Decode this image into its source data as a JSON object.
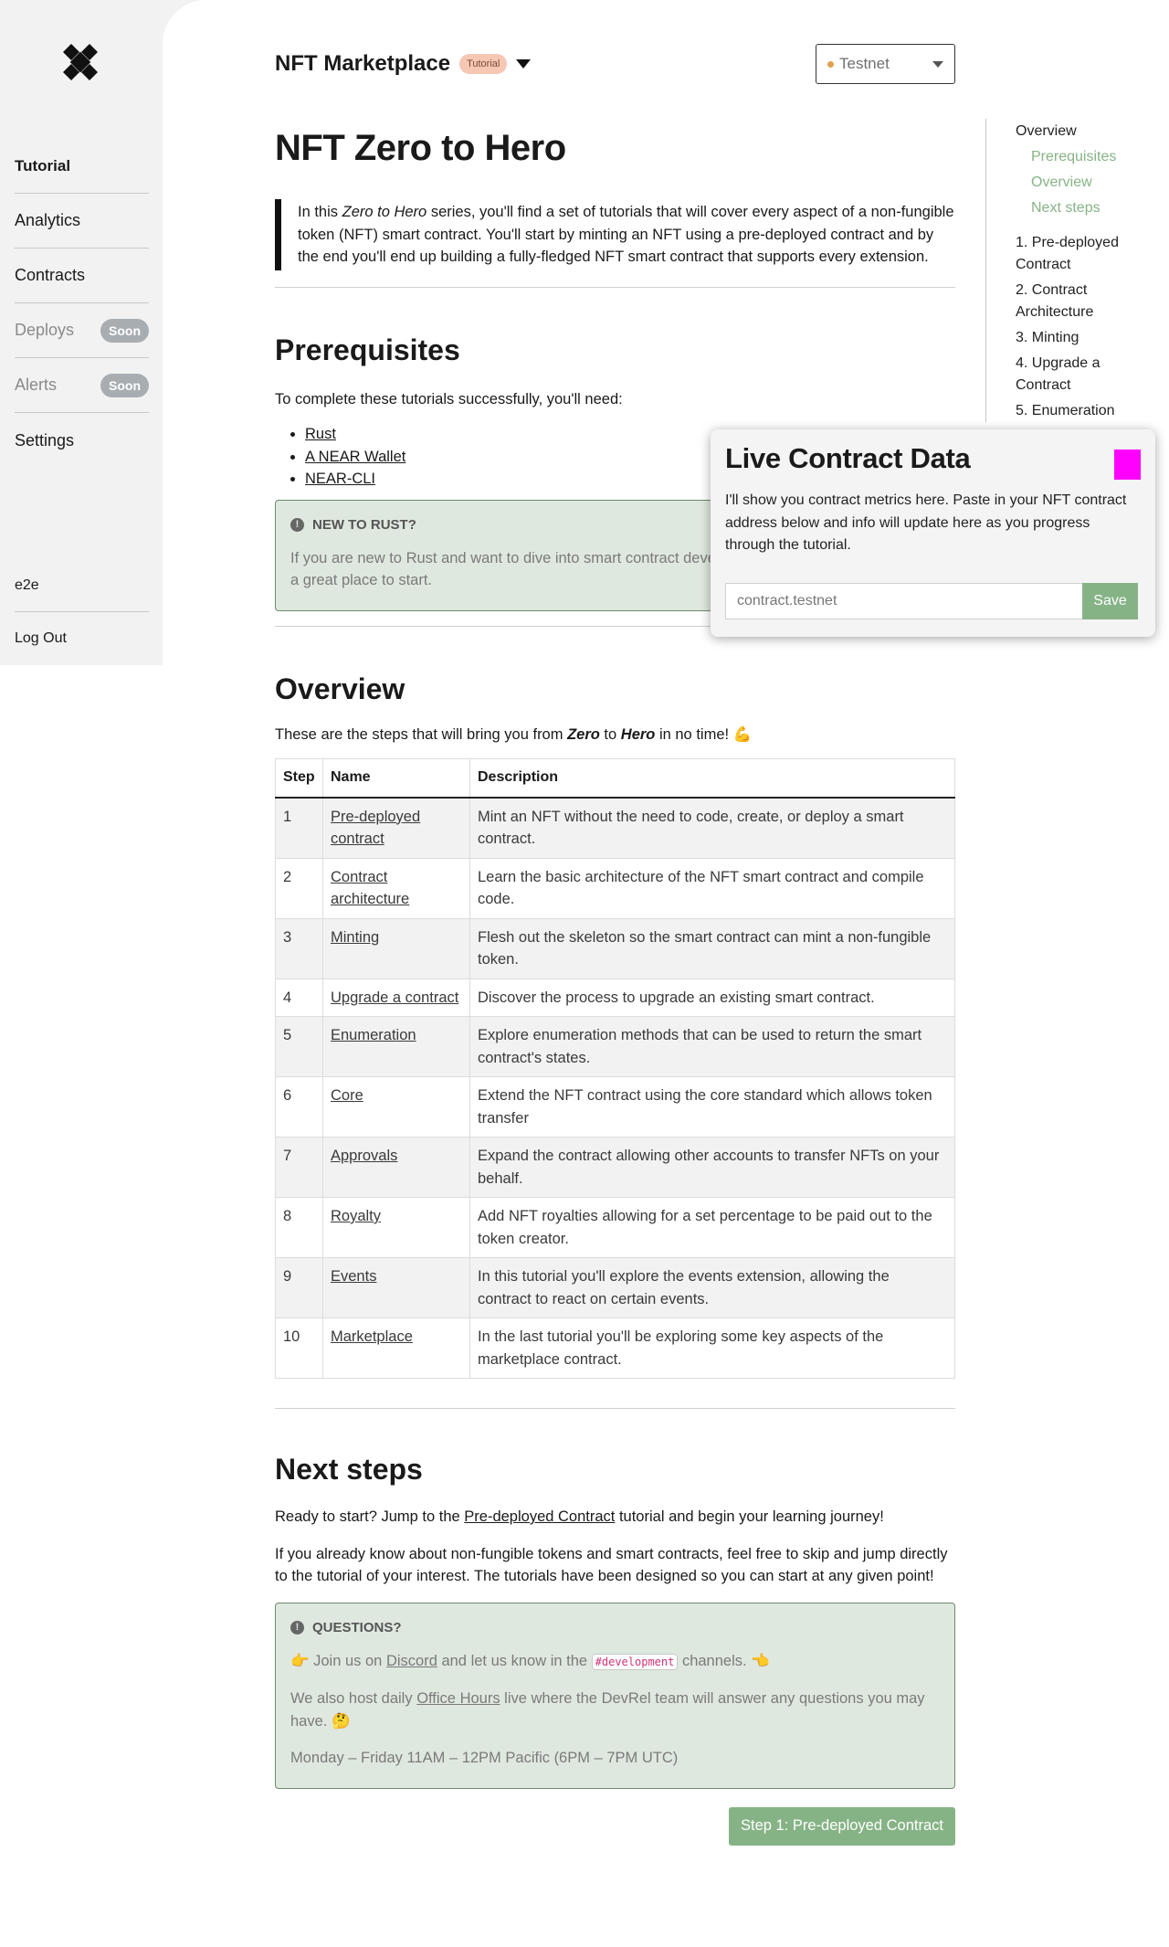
{
  "sidebar": {
    "logo": "brand-logo",
    "items": [
      {
        "label": "Tutorial"
      },
      {
        "label": "Analytics"
      },
      {
        "label": "Contracts"
      },
      {
        "label": "Deploys",
        "badge": "Soon"
      },
      {
        "label": "Alerts",
        "badge": "Soon"
      },
      {
        "label": "Settings"
      }
    ],
    "user": "e2e",
    "logout": "Log Out"
  },
  "header": {
    "project": "NFT Marketplace",
    "badge": "Tutorial",
    "network": "Testnet",
    "network_dot_color": "#e0a050"
  },
  "content": {
    "title": "NFT Zero to Hero",
    "intro": {
      "pre": "In this ",
      "em": "Zero to Hero",
      "post": " series, you'll find a set of tutorials that will cover every aspect of a non-fungible token (NFT) smart contract. You'll start by minting an NFT using a pre-deployed contract and by the end you'll end up building a fully-fledged NFT smart contract that supports every extension."
    },
    "prereq": {
      "heading": "Prerequisites",
      "text": "To complete these tutorials successfully, you'll need:",
      "items": [
        "Rust",
        "A NEAR Wallet",
        "NEAR-CLI"
      ],
      "note_title": "NEW TO RUST?",
      "note_text": "If you are new to Rust and want to dive into smart contract development, our Quick-start guide is a great place to start."
    },
    "overview": {
      "heading": "Overview",
      "text_pre": "These are the steps that will bring you from ",
      "zero": "Zero",
      "to": " to ",
      "hero": "Hero",
      "text_post": " in no time! 💪",
      "columns": [
        "Step",
        "Name",
        "Description"
      ],
      "rows": [
        [
          "1",
          "Pre-deployed contract",
          "Mint an NFT without the need to code, create, or deploy a smart contract."
        ],
        [
          "2",
          "Contract architecture",
          "Learn the basic architecture of the NFT smart contract and compile code."
        ],
        [
          "3",
          "Minting",
          "Flesh out the skeleton so the smart contract can mint a non-fungible token."
        ],
        [
          "4",
          "Upgrade a contract",
          "Discover the process to upgrade an existing smart contract."
        ],
        [
          "5",
          "Enumeration",
          "Explore enumeration methods that can be used to return the smart contract's states."
        ],
        [
          "6",
          "Core",
          "Extend the NFT contract using the core standard which allows token transfer"
        ],
        [
          "7",
          "Approvals",
          "Expand the contract allowing other accounts to transfer NFTs on your behalf."
        ],
        [
          "8",
          "Royalty",
          "Add NFT royalties allowing for a set percentage to be paid out to the token creator."
        ],
        [
          "9",
          "Events",
          "In this tutorial you'll explore the events extension, allowing the contract to react on certain events."
        ],
        [
          "10",
          "Marketplace",
          "In the last tutorial you'll be exploring some key aspects of the marketplace contract."
        ]
      ]
    },
    "next": {
      "heading": "Next steps",
      "p1_pre": "Ready to start? Jump to the ",
      "p1_link": "Pre-deployed Contract",
      "p1_post": " tutorial and begin your learning journey!",
      "p2": "If you already know about non-fungible tokens and smart contracts, feel free to skip and jump directly to the tutorial of your interest. The tutorials have been designed so you can start at any given point!",
      "q_title": "QUESTIONS?",
      "q1_pre": "👉 Join us on ",
      "q1_link": "Discord",
      "q1_mid": " and let us know in the ",
      "q1_code": "#development",
      "q1_post": " channels. 👈",
      "q2_pre": "We also host daily ",
      "q2_link": "Office Hours",
      "q2_post": " live where the DevRel team will answer any questions you may have. 🤔",
      "q3": "Monday – Friday 11AM – 12PM Pacific (6PM – 7PM UTC)",
      "cta": "Step 1: Pre-deployed Contract"
    }
  },
  "toc": {
    "overview": "Overview",
    "subs": [
      "Prerequisites",
      "Overview",
      "Next steps"
    ],
    "items": [
      "1. Pre-deployed Contract",
      "2. Contract Architecture",
      "3. Minting",
      "4. Upgrade a Contract",
      "5. Enumeration"
    ]
  },
  "panel": {
    "title": "Live Contract Data",
    "text": "I'll show you contract metrics here. Paste in your NFT contract address below and info will update here as you progress through the tutorial.",
    "placeholder": "contract.testnet",
    "save": "Save"
  },
  "colors": {
    "accent_green": "#86b386",
    "admonition_bg": "#dfe8df",
    "close_magenta": "#ff00ff"
  }
}
